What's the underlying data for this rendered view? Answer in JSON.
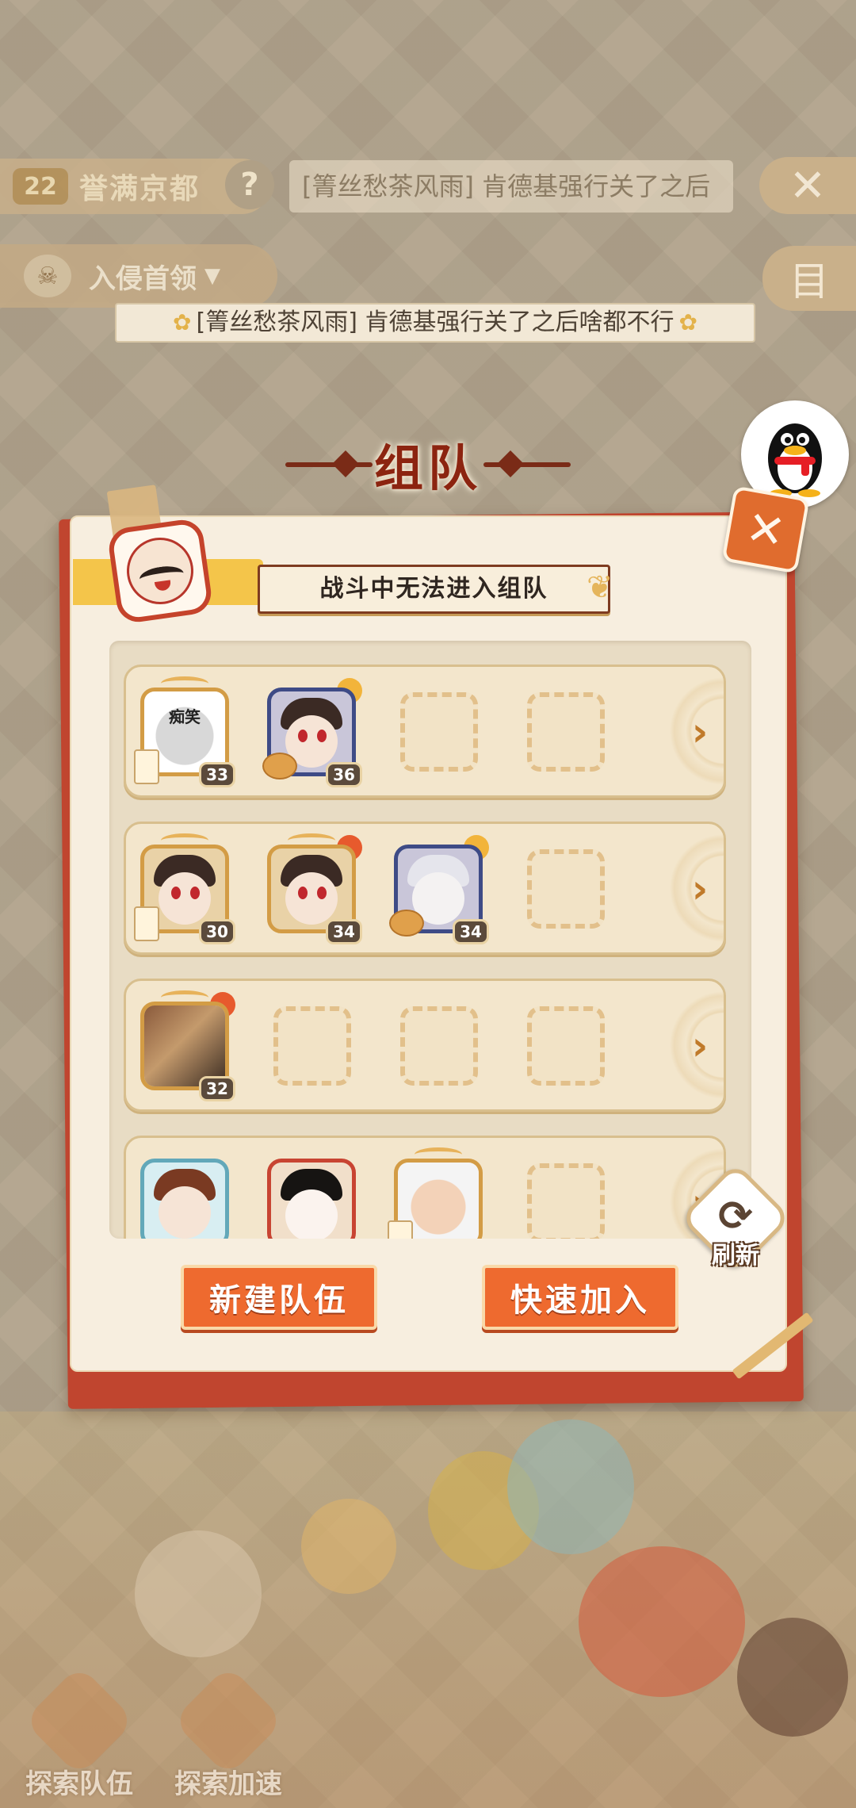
{
  "hud": {
    "level": "22",
    "stage_name": "誉满京都",
    "help_symbol": "?",
    "notice_text": "[箐丝愁茶风雨] 肯德基强行关了之后",
    "close_symbol": "✕",
    "boss_label": "入侵首领",
    "boss_caret": "▼",
    "menu_symbol": "目",
    "marquee_text": "[箐丝愁茶风雨] 肯德基强行关了之后啥都不行"
  },
  "modal": {
    "title": "组队",
    "close_symbol": "✕",
    "toast": "战斗中无法进入组队",
    "teams": [
      {
        "members": [
          {
            "level": "33",
            "caption": "痴笑"
          },
          {
            "level": "36"
          }
        ],
        "arrow": "›"
      },
      {
        "members": [
          {
            "level": "30"
          },
          {
            "level": "34"
          },
          {
            "level": "34"
          }
        ],
        "arrow": "›"
      },
      {
        "members": [
          {
            "level": "32"
          }
        ],
        "arrow": "›"
      },
      {
        "members": [
          {},
          {},
          {}
        ],
        "arrow": "›"
      }
    ],
    "refresh_symbol": "⟳",
    "refresh_label": "刷新",
    "new_team_button": "新建队伍",
    "quick_join_button": "快速加入"
  },
  "bottom": {
    "tabs": [
      "探索队伍",
      "探索加速"
    ]
  },
  "colors": {
    "modal_red": "#c0452f",
    "button_orange": "#ee6a2f",
    "title_red": "#8c2410"
  }
}
